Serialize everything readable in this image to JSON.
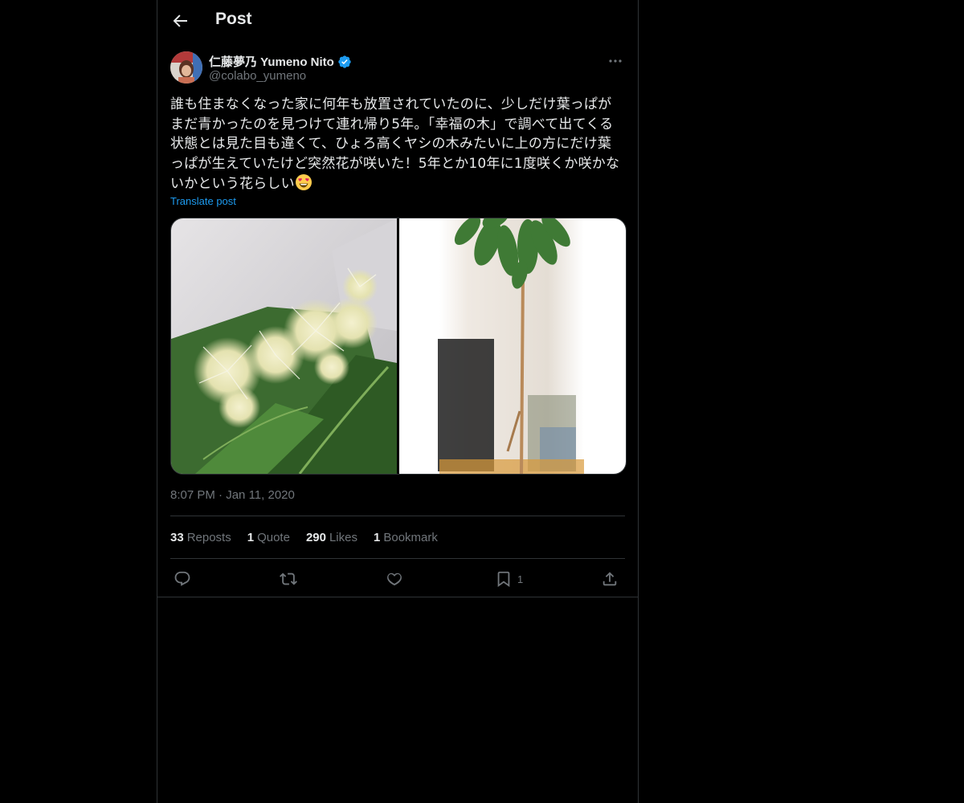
{
  "header": {
    "title": "Post"
  },
  "author": {
    "display_name": "仁藤夢乃 Yumeno Nito",
    "handle": "@colabo_yumeno",
    "verified": true
  },
  "tweet": {
    "text": "誰も住まなくなった家に何年も放置されていたのに、少しだけ葉っぱがまだ青かったのを見つけて連れ帰り5年。「幸福の木」で調べて出てくる状態とは見た目も違くて、ひょろ高くヤシの木みたいに上の方にだけ葉っぱが生えていたけど突然花が咲いた！5年とか10年に1度咲くか咲かないかという花らしい",
    "emoji": "smiling-face-with-heart-eyes",
    "translate_label": "Translate post"
  },
  "media": [
    {
      "description_icon": "flower-photo"
    },
    {
      "description_icon": "tree-photo"
    }
  ],
  "meta": {
    "time": "8:07 PM",
    "separator": "·",
    "date": "Jan 11, 2020"
  },
  "stats": {
    "reposts_count": "33",
    "reposts_label": "Reposts",
    "quotes_count": "1",
    "quotes_label": "Quote",
    "likes_count": "290",
    "likes_label": "Likes",
    "bookmarks_count": "1",
    "bookmarks_label": "Bookmark"
  },
  "actions": {
    "reply_icon": "reply-icon",
    "repost_icon": "repost-icon",
    "like_icon": "heart-icon",
    "bookmark_icon": "bookmark-icon",
    "bookmark_count": "1",
    "share_icon": "share-icon"
  },
  "colors": {
    "background": "#000000",
    "text": "#e7e9ea",
    "muted": "#71767b",
    "link": "#1d9bf0",
    "border": "#2f3336"
  }
}
